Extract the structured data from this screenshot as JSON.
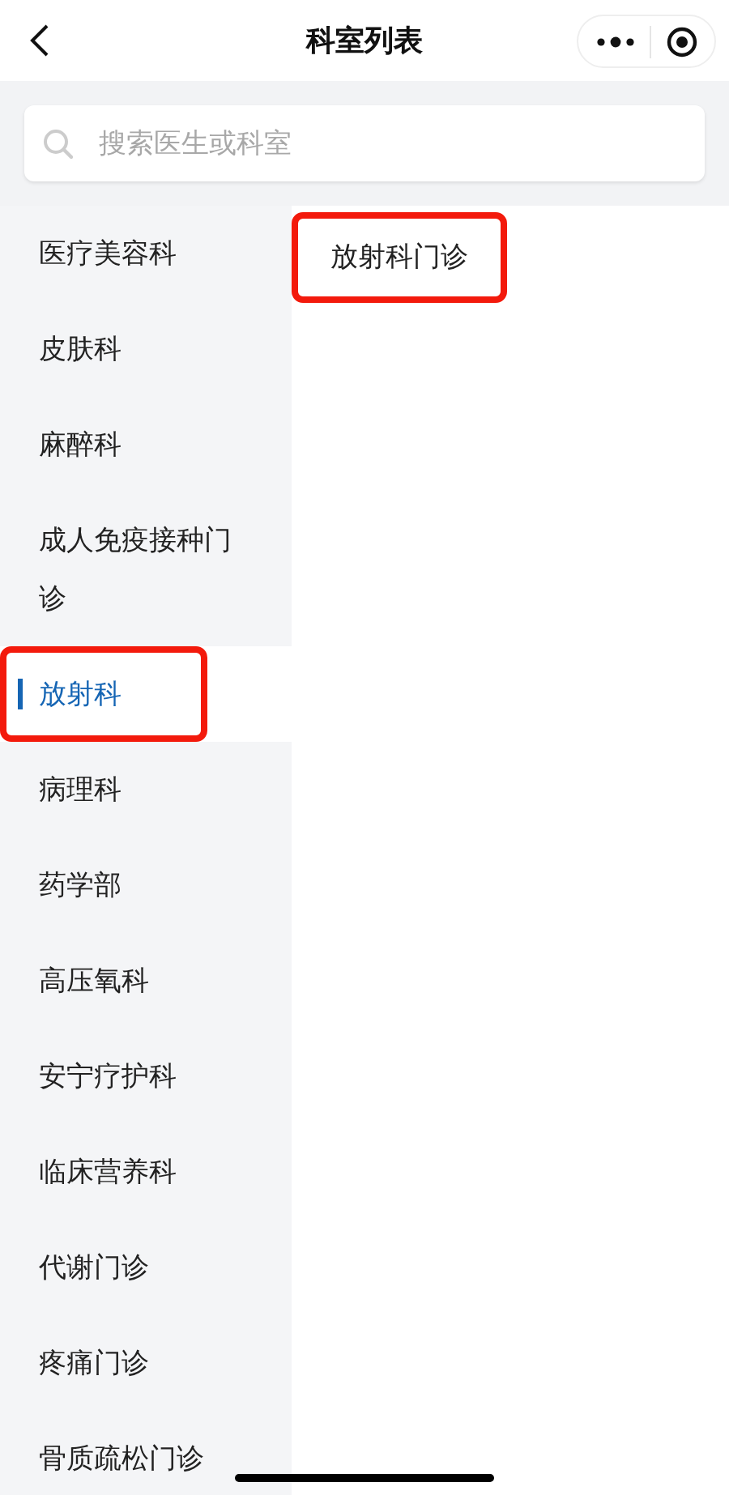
{
  "header": {
    "title": "科室列表"
  },
  "search": {
    "placeholder": "搜索医生或科室"
  },
  "departments": [
    {
      "name": "医疗美容科",
      "selected": false,
      "highlighted": false
    },
    {
      "name": "皮肤科",
      "selected": false,
      "highlighted": false
    },
    {
      "name": "麻醉科",
      "selected": false,
      "highlighted": false
    },
    {
      "name": "成人免疫接种门诊",
      "selected": false,
      "highlighted": false
    },
    {
      "name": "放射科",
      "selected": true,
      "highlighted": true
    },
    {
      "name": "病理科",
      "selected": false,
      "highlighted": false
    },
    {
      "name": "药学部",
      "selected": false,
      "highlighted": false
    },
    {
      "name": "高压氧科",
      "selected": false,
      "highlighted": false
    },
    {
      "name": "安宁疗护科",
      "selected": false,
      "highlighted": false
    },
    {
      "name": "临床营养科",
      "selected": false,
      "highlighted": false
    },
    {
      "name": "代谢门诊",
      "selected": false,
      "highlighted": false
    },
    {
      "name": "疼痛门诊",
      "selected": false,
      "highlighted": false
    },
    {
      "name": "骨质疏松门诊",
      "selected": false,
      "highlighted": false
    }
  ],
  "clinics": [
    {
      "name": "放射科门诊",
      "highlighted": true
    }
  ]
}
